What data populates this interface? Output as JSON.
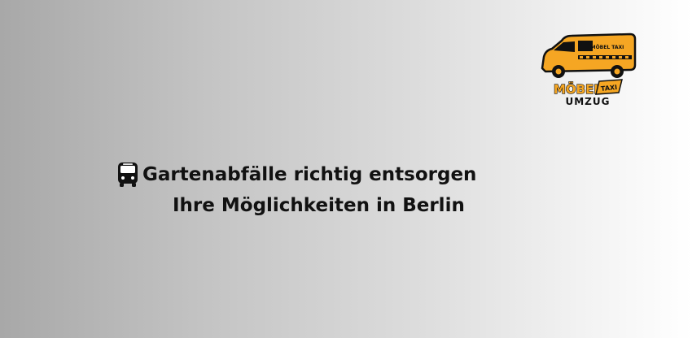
{
  "logo": {
    "van_label": "MÖBEL TAXI",
    "brand_main": "MÖBEL",
    "brand_badge": "TAXI",
    "brand_sub": "UMZUG",
    "accent_color": "#f5a623",
    "outline_color": "#111111"
  },
  "headline": {
    "icon": "bus-icon",
    "line1": "Gartenabfälle richtig entsorgen",
    "line2": "Ihre Möglichkeiten in Berlin"
  }
}
